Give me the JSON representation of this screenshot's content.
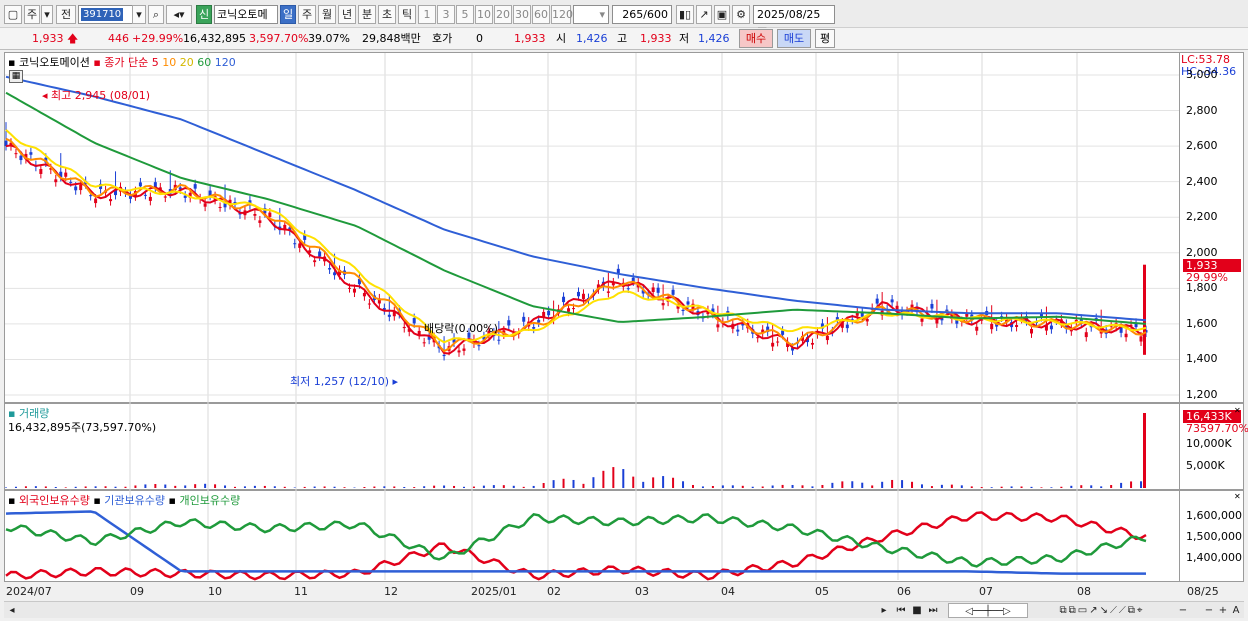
{
  "toolbar": {
    "period_label": "주",
    "prev_label": "전",
    "code_value": "391710",
    "shin_label": "신",
    "stock_name": "코닉오토메",
    "period_tabs": [
      "일",
      "주",
      "월",
      "년",
      "분",
      "초",
      "틱"
    ],
    "active_tab": "일",
    "intervals": [
      "1",
      "3",
      "5",
      "10",
      "20",
      "30",
      "60",
      "120"
    ],
    "count": "265",
    "count_max": "/600",
    "date": "2025/08/25"
  },
  "quote": {
    "price": "1,933",
    "change": "446",
    "change_pct": "+29.99%",
    "volume": "16,432,895",
    "volume_ratio": "3,597.70%",
    "turnover": "39.07%",
    "amount": "29,848백만",
    "hoga_label": "호가",
    "hoga_value": "0",
    "ask": "1,933",
    "open_label": "시",
    "open": "1,426",
    "high_label": "고",
    "high": "1,933",
    "low_label": "저",
    "low": "1,426",
    "buy_label": "매수",
    "sell_label": "매도",
    "eval_label": "평"
  },
  "price_panel": {
    "name_label": "코닉오토메이션",
    "legend_title": "종가 단순",
    "ma_labels": [
      "5",
      "10",
      "20",
      "60",
      "120"
    ],
    "lc": "LC:53.78",
    "hc": "HC:-34.36",
    "y_ticks": [
      "3,000",
      "2,800",
      "2,600",
      "2,400",
      "2,200",
      "2,000",
      "1,800",
      "1,600",
      "1,400",
      "1,200"
    ],
    "high_note": "최고 2,945 (08/01)",
    "low_note": "최저 1,257 (12/10)",
    "dividend_note": "배당락(0.00%)",
    "last_price_tag": "1,933",
    "last_pct_tag": "29.99%"
  },
  "volume_panel": {
    "title": "거래량",
    "value": "16,432,895주(73,597.70%)",
    "y_ticks": [
      "10,000K",
      "5,000K"
    ],
    "tag_value": "16,433K",
    "tag_pct": "73597.70%"
  },
  "holdings_panel": {
    "legend": [
      "외국인보유수량",
      "기관보유수량",
      "개인보유수량"
    ],
    "y_ticks": [
      "1,600,000",
      "1,500,000",
      "1,400,000"
    ]
  },
  "date_axis": [
    "2024/07",
    "09",
    "10",
    "11",
    "12",
    "2025/01",
    "02",
    "03",
    "04",
    "05",
    "06",
    "07",
    "08",
    "08/25"
  ],
  "colors": {
    "up": "#e2001a",
    "down": "#1a3fd6",
    "ma5": "#e2001a",
    "ma10": "#ff8c00",
    "ma20": "#ffe100",
    "ma60": "#1f9a3b",
    "ma120": "#2f5fd6",
    "foreign": "#e2001a",
    "institution": "#2f5fd6",
    "individual": "#1f9a3b"
  },
  "chart_data": [
    {
      "type": "line",
      "title": "코닉오토메이션",
      "series": [
        {
          "name": "5",
          "x": [
            "2024/07",
            "2024/08",
            "2024/09",
            "2024/10",
            "2024/11",
            "2024/12",
            "2025/01",
            "2025/02",
            "2025/03",
            "2025/04",
            "2025/05",
            "2025/06",
            "2025/07",
            "2025/08"
          ],
          "values": [
            2600,
            2330,
            2350,
            2200,
            1800,
            1450,
            1600,
            1850,
            1650,
            1480,
            1700,
            1620,
            1600,
            1560
          ]
        },
        {
          "name": "10",
          "x": [
            "2024/07",
            "2024/08",
            "2024/09",
            "2024/10",
            "2024/11",
            "2024/12",
            "2025/01",
            "2025/02",
            "2025/03",
            "2025/04",
            "2025/05",
            "2025/06",
            "2025/07",
            "2025/08"
          ],
          "values": [
            2620,
            2340,
            2360,
            2220,
            1850,
            1470,
            1580,
            1840,
            1660,
            1500,
            1680,
            1630,
            1600,
            1560
          ]
        },
        {
          "name": "20",
          "x": [
            "2024/07",
            "2024/08",
            "2024/09",
            "2024/10",
            "2024/11",
            "2024/12",
            "2025/01",
            "2025/02",
            "2025/03",
            "2025/04",
            "2025/05",
            "2025/06",
            "2025/07",
            "2025/08"
          ],
          "values": [
            2680,
            2380,
            2330,
            2250,
            1900,
            1500,
            1560,
            1780,
            1680,
            1560,
            1660,
            1630,
            1610,
            1570
          ]
        },
        {
          "name": "60",
          "x": [
            "2024/07",
            "2024/08",
            "2024/09",
            "2024/10",
            "2024/11",
            "2024/12",
            "2025/01",
            "2025/02",
            "2025/03",
            "2025/04",
            "2025/05",
            "2025/06",
            "2025/07",
            "2025/08"
          ],
          "values": [
            2900,
            2620,
            2420,
            2300,
            2150,
            1900,
            1700,
            1610,
            1640,
            1680,
            1660,
            1630,
            1640,
            1600
          ]
        },
        {
          "name": "120",
          "x": [
            "2024/07",
            "2024/08",
            "2024/09",
            "2024/10",
            "2024/11",
            "2024/12",
            "2025/01",
            "2025/02",
            "2025/03",
            "2025/04",
            "2025/05",
            "2025/06",
            "2025/07",
            "2025/08"
          ],
          "values": [
            2990,
            2880,
            2750,
            2550,
            2350,
            2130,
            1980,
            1880,
            1800,
            1730,
            1680,
            1660,
            1660,
            1620
          ]
        }
      ],
      "ylim": [
        1200,
        3000
      ]
    },
    {
      "type": "bar",
      "title": "거래량",
      "categories": [
        "2024/07",
        "2024/08",
        "2024/09",
        "2024/10",
        "2024/11",
        "2024/12",
        "2025/01",
        "2025/02",
        "2025/03",
        "2025/04",
        "2025/05",
        "2025/06",
        "2025/07",
        "2025/08",
        "2025/08/25"
      ],
      "values": [
        300,
        250,
        800,
        300,
        200,
        400,
        500,
        3500,
        400,
        500,
        1500,
        300,
        200,
        1200,
        16433
      ],
      "ylim": [
        0,
        16433
      ]
    },
    {
      "type": "line",
      "series": [
        {
          "name": "외국인보유수량",
          "values": [
            1320,
            1340,
            1330,
            1320,
            1330,
            1460,
            1320,
            1350,
            1320,
            1380,
            1500,
            1600,
            1590,
            1500
          ]
        },
        {
          "name": "기관보유수량",
          "values": [
            1610,
            1620,
            1340,
            1340,
            1340,
            1340,
            1340,
            1340,
            1340,
            1340,
            1340,
            1340,
            1330,
            1330
          ]
        },
        {
          "name": "개인보유수량",
          "values": [
            1550,
            1480,
            1570,
            1540,
            1560,
            1400,
            1590,
            1570,
            1590,
            1540,
            1450,
            1380,
            1400,
            1500
          ]
        }
      ],
      "ylim": [
        1300,
        1650
      ]
    }
  ]
}
